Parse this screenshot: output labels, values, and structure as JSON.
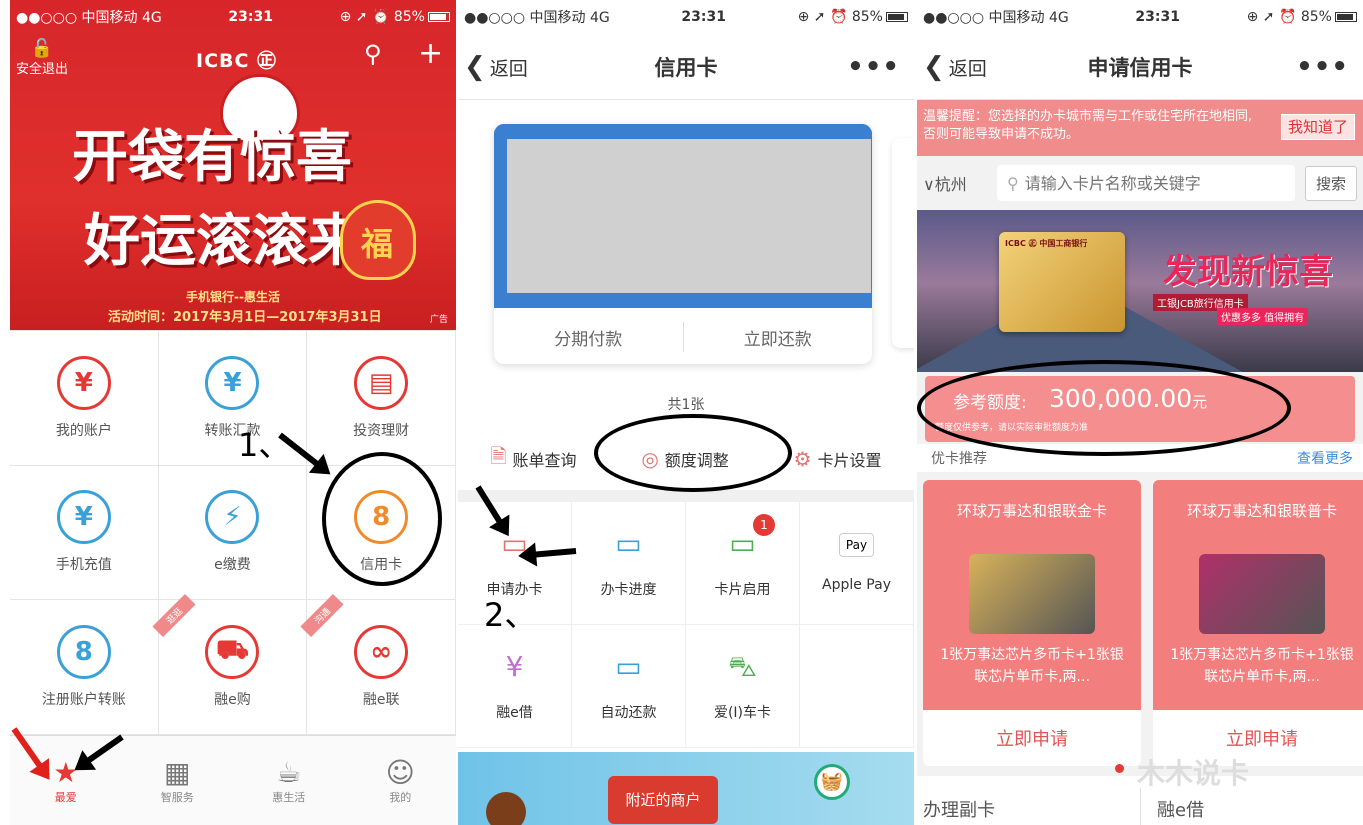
{
  "colors": {
    "brand_red": "#d7262a",
    "accent_pink": "#f27e7e",
    "link_blue": "#3b8fd9",
    "annotation_black": "#000000",
    "annotation_red": "#e0201a"
  },
  "panel1": {
    "status": {
      "carrier": "●●○○○ 中国移动  4G",
      "time": "23:31",
      "right": "⊕ ➚ ⏰ 85%"
    },
    "banner": {
      "logout_label": "安全退出",
      "logo": "ICBC ㊣",
      "headline_1": "开袋有惊喜",
      "headline_2": "好运滚滚来",
      "bag_char": "福",
      "subtitle": "手机银行--惠生活",
      "date": "活动时间：2017年3月1日—2017年3月31日",
      "ad": "广告"
    },
    "grid": [
      {
        "label": "我的账户",
        "icon": "¥",
        "icon_name": "yuan-account-icon",
        "color": "#e53935"
      },
      {
        "label": "转账汇款",
        "icon": "¥",
        "icon_name": "transfer-icon",
        "color": "#3aa0d8"
      },
      {
        "label": "投资理财",
        "icon": "▤",
        "icon_name": "abacus-icon",
        "color": "#e53935"
      },
      {
        "label": "手机充值",
        "icon": "¥",
        "icon_name": "phone-topup-icon",
        "color": "#3aa0d8"
      },
      {
        "label": "e缴费",
        "icon": "⚡",
        "icon_name": "droplet-bolt-icon",
        "color": "#3aa0d8"
      },
      {
        "label": "信用卡",
        "icon": "8",
        "icon_name": "credit-card-icon",
        "color": "#f08a2a"
      },
      {
        "label": "注册账户转账",
        "icon": "8",
        "icon_name": "register-transfer-icon",
        "color": "#3aa0d8"
      },
      {
        "label": "融e购",
        "icon": "⛟",
        "icon_name": "cart-icon",
        "color": "#e53935",
        "ribbon": "逛逛"
      },
      {
        "label": "融e联",
        "icon": "∞",
        "icon_name": "link-rings-icon",
        "color": "#e53935",
        "ribbon": "沟通"
      }
    ],
    "tabs": [
      {
        "label": "最爱",
        "icon": "★",
        "icon_name": "star-icon",
        "active": true
      },
      {
        "label": "智服务",
        "icon": "▦",
        "icon_name": "calendar-clock-icon"
      },
      {
        "label": "惠生活",
        "icon": "☕",
        "icon_name": "coffee-icon"
      },
      {
        "label": "我的",
        "icon": "☺",
        "icon_name": "smile-icon"
      }
    ],
    "annotation_label": "1、"
  },
  "panel2": {
    "status": {
      "carrier": "●●○○○ 中国移动  4G",
      "time": "23:31",
      "right": "⊕ ➚ ⏰ 85%"
    },
    "nav": {
      "back": "返回",
      "title": "信用卡",
      "more": "•••"
    },
    "card_actions": [
      "分期付款",
      "立即还款"
    ],
    "card_count": "共1张",
    "quick": [
      {
        "label": "账单查询",
        "icon": "🗎",
        "icon_name": "bill-query-icon"
      },
      {
        "label": "额度调整",
        "icon": "◎",
        "icon_name": "limit-adjust-icon"
      },
      {
        "label": "卡片设置",
        "icon": "⚙",
        "icon_name": "card-settings-icon"
      }
    ],
    "grid": [
      {
        "label": "申请办卡",
        "icon": "▭",
        "icon_name": "apply-card-icon",
        "color": "#e57373"
      },
      {
        "label": "办卡进度",
        "icon": "▭",
        "icon_name": "progress-card-icon",
        "color": "#3aa0d8"
      },
      {
        "label": "卡片启用",
        "icon": "▭",
        "icon_name": "activate-card-icon",
        "color": "#4caf50",
        "badge": "1"
      },
      {
        "label": "Apple Pay",
        "icon": "Pay",
        "icon_name": "apple-pay-icon",
        "color": "#000000"
      },
      {
        "label": "融e借",
        "icon": "¥",
        "icon_name": "loan-icon",
        "color": "#c06fd0"
      },
      {
        "label": "自动还款",
        "icon": "▭",
        "icon_name": "auto-repay-icon",
        "color": "#3aa0d8"
      },
      {
        "label": "爱(I)车卡",
        "icon": "⛍",
        "icon_name": "car-icon",
        "color": "#4caf50"
      },
      {
        "label": "",
        "icon": "",
        "icon_name": "empty-slot",
        "color": "#ffffff"
      }
    ],
    "banner_label": "附近的商户",
    "annotation_label": "2、"
  },
  "panel3": {
    "status": {
      "carrier": "●●○○○ 中国移动  4G",
      "time": "23:31",
      "right": "⊕ ➚ ⏰ 85%"
    },
    "nav": {
      "back": "返回",
      "title": "申请信用卡",
      "more": "•••"
    },
    "notice": "温馨提醒：您选择的办卡城市需与工作或住宅所在地相同,否则可能导致申请不成功。",
    "notice_button": "我知道了",
    "city": "∨杭州",
    "search_placeholder": "请输入卡片名称或关键字",
    "search_button": "搜索",
    "banner": {
      "card_text": "ICBC ㊣ 中国工商银行",
      "headline": "发现新惊喜",
      "tag1": "工银JCB旅行信用卡",
      "tag2": "优惠多多 值得拥有"
    },
    "limit_label": "参考额度:",
    "limit_value": "300,000.00",
    "limit_unit": "元",
    "limit_note": "额度仅供参考，请以实际审批额度为准",
    "rec_title": "优卡推荐",
    "rec_more": "查看更多",
    "cards": [
      {
        "name": "环球万事达和银联金卡",
        "desc": "1张万事达芯片多币卡+1张银联芯片单币卡,两...",
        "apply": "立即申请",
        "card_color": "#d8b25a"
      },
      {
        "name": "环球万事达和银联普卡",
        "desc": "1张万事达芯片多币卡+1张银联芯片单币卡,两...",
        "apply": "立即申请",
        "card_color": "#b0306a"
      }
    ],
    "watermark": "木木说卡",
    "bottom_items": [
      "办理副卡",
      "融e借"
    ]
  }
}
